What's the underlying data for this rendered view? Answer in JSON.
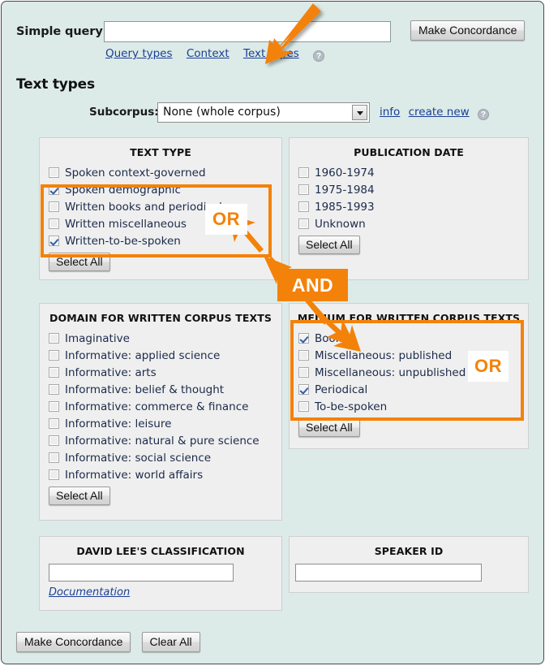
{
  "query": {
    "label": "Simple query:",
    "value": "",
    "placeholder": "",
    "submit_label": "Make Concordance"
  },
  "nav": {
    "links": [
      {
        "label": "Query types"
      },
      {
        "label": "Context"
      },
      {
        "label": "Text types"
      }
    ],
    "help_icon": "?"
  },
  "section": {
    "title": "Text types"
  },
  "subcorpus": {
    "label": "Subcorpus:",
    "selected": "None (whole corpus)",
    "links": [
      {
        "label": "info"
      },
      {
        "label": "create new"
      }
    ],
    "help_icon": "?"
  },
  "panels": {
    "text_type": {
      "title": "TEXT TYPE",
      "items": [
        {
          "label": "Spoken context-governed",
          "checked": false
        },
        {
          "label": "Spoken demographic",
          "checked": true
        },
        {
          "label": "Written books and periodicals",
          "checked": false
        },
        {
          "label": "Written miscellaneous",
          "checked": false
        },
        {
          "label": "Written-to-be-spoken",
          "checked": true
        }
      ],
      "select_all_label": "Select All"
    },
    "publication_date": {
      "title": "PUBLICATION DATE",
      "items": [
        {
          "label": "1960-1974",
          "checked": false
        },
        {
          "label": "1975-1984",
          "checked": false
        },
        {
          "label": "1985-1993",
          "checked": false
        },
        {
          "label": "Unknown",
          "checked": false
        }
      ],
      "select_all_label": "Select All"
    },
    "domain": {
      "title": "DOMAIN FOR WRITTEN CORPUS TEXTS",
      "items": [
        {
          "label": "Imaginative",
          "checked": false
        },
        {
          "label": "Informative: applied science",
          "checked": false
        },
        {
          "label": "Informative: arts",
          "checked": false
        },
        {
          "label": "Informative: belief & thought",
          "checked": false
        },
        {
          "label": "Informative: commerce & finance",
          "checked": false
        },
        {
          "label": "Informative: leisure",
          "checked": false
        },
        {
          "label": "Informative: natural & pure science",
          "checked": false
        },
        {
          "label": "Informative: social science",
          "checked": false
        },
        {
          "label": "Informative: world affairs",
          "checked": false
        }
      ],
      "select_all_label": "Select All"
    },
    "medium": {
      "title": "MEDIUM FOR WRITTEN CORPUS TEXTS",
      "items": [
        {
          "label": "Book",
          "checked": true
        },
        {
          "label": "Miscellaneous: published",
          "checked": false
        },
        {
          "label": "Miscellaneous: unpublished",
          "checked": false
        },
        {
          "label": "Periodical",
          "checked": true
        },
        {
          "label": "To-be-spoken",
          "checked": false
        }
      ],
      "select_all_label": "Select All"
    },
    "david_lee": {
      "title": "DAVID LEE'S CLASSIFICATION",
      "value": "",
      "placeholder": "",
      "documentation_label": "Documentation"
    },
    "speaker_id": {
      "title": "SPEAKER ID",
      "value": "",
      "placeholder": ""
    }
  },
  "footer": {
    "make_concordance_label": "Make Concordance",
    "clear_all_label": "Clear All"
  },
  "annotations": {
    "or_text_type": "OR",
    "or_medium": "OR",
    "and": "AND",
    "accent_color": "#f3820a",
    "page_background": "#dcebe8",
    "panel_background": "#efefef",
    "link_color": "#1c3f94"
  }
}
